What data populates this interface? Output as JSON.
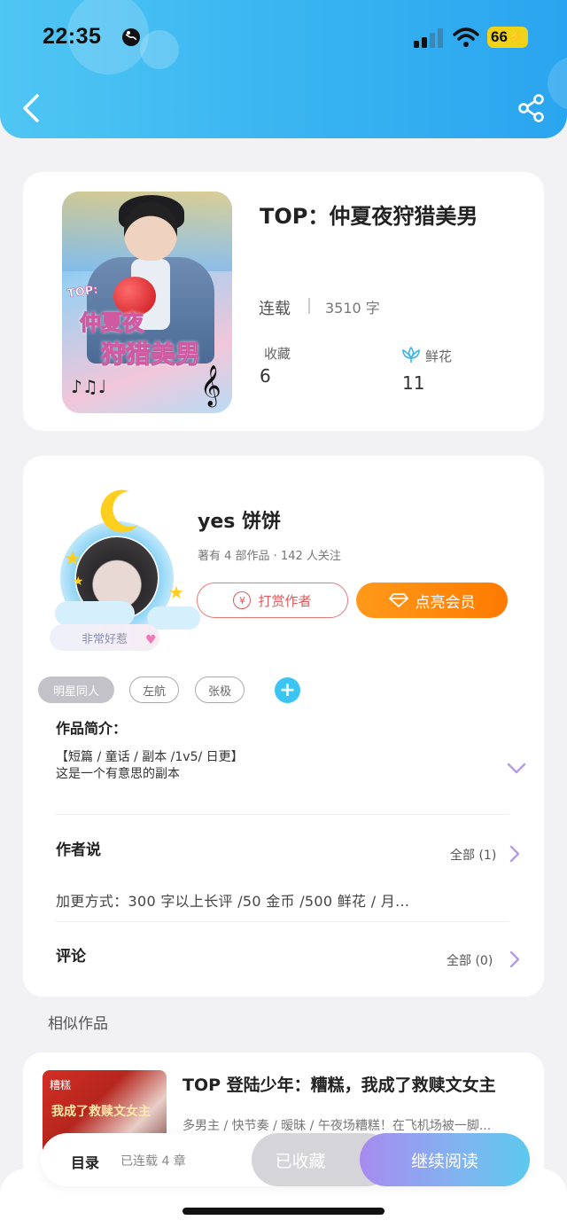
{
  "status_bar": {
    "time": "22:35",
    "battery": "66"
  },
  "header": {
    "back_icon": "chevron-left-icon",
    "share_icon": "share-icon"
  },
  "book": {
    "title": "TOP：仲夏夜狩猎美男",
    "status": "连载",
    "word_count": "3510 字",
    "favorites_label": "收藏",
    "favorites_count": "6",
    "flowers_label": "鲜花",
    "flowers_count": "11",
    "cover_text_top": "TOP:",
    "cover_text_line1": "仲夏夜",
    "cover_text_line2": "狩猎美男"
  },
  "author": {
    "name": "yes 饼饼",
    "stats": "著有 4 部作品 · 142 人关注",
    "badge": "非常好惹",
    "tip_label": "打赏作者",
    "vip_label": "点亮会员"
  },
  "tags": [
    "明星同人",
    "左航",
    "张极"
  ],
  "intro": {
    "title": "作品简介：",
    "line1": "【短篇 / 童话 / 副本 /1v5/ 日更】",
    "line2": "这是一个有意思的副本"
  },
  "author_says": {
    "title": "作者说",
    "all_label": "全部 (1)",
    "text": "加更方式：300 字以上长评 /50 金币 /500 鲜花 / 月..."
  },
  "comments": {
    "title": "评论",
    "all_label": "全部 (0)"
  },
  "similar": {
    "heading": "相似作品",
    "items": [
      {
        "title": "TOP 登陆少年：糟糕，我成了救赎文女主",
        "desc": "多男主 / 快节奏 / 暧昧 / 午夜场糟糕！在飞机场被一脚...",
        "cover_text1": "糟糕",
        "cover_text2": "我成了救赎文女主"
      }
    ]
  },
  "bottom_bar": {
    "toc_label": "目录",
    "serial_label": "已连载 4 章",
    "collected_label": "已收藏",
    "read_label": "继续阅读"
  },
  "colors": {
    "header": "#38b3f1",
    "accent_orange": "#ff8a0f",
    "tip_red": "#e0595b",
    "read_purple": "#a78bf0"
  }
}
